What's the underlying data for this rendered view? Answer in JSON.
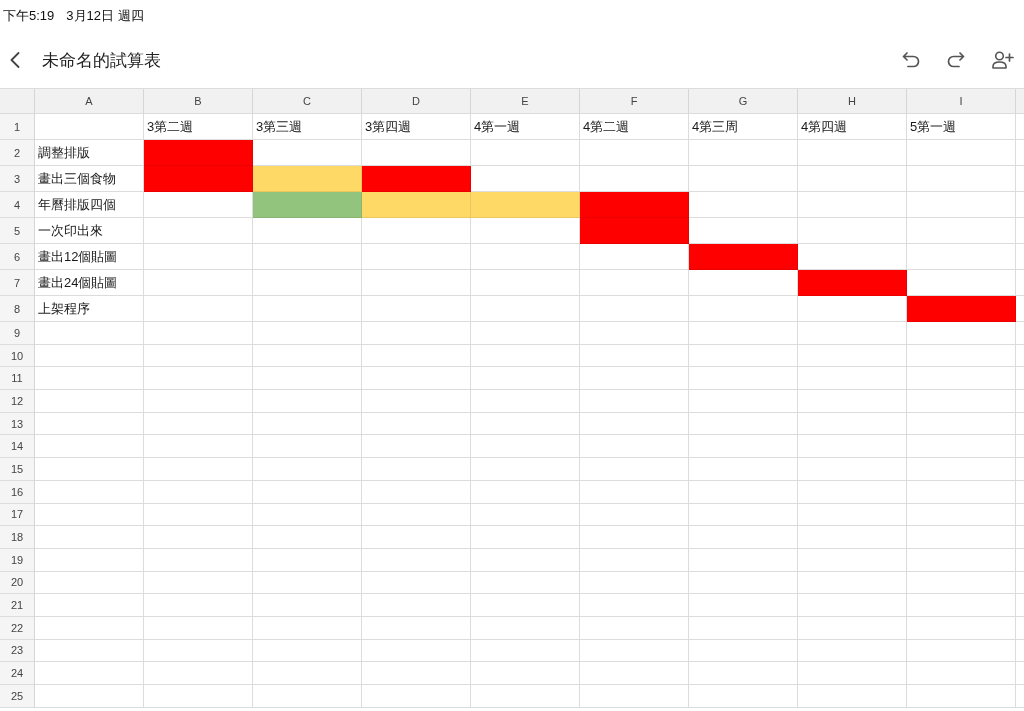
{
  "status_bar": {
    "time": "下午5:19",
    "date": "3月12日 週四"
  },
  "toolbar": {
    "title": "未命名的試算表"
  },
  "sheet": {
    "columns": [
      "A",
      "B",
      "C",
      "D",
      "E",
      "F",
      "G",
      "H",
      "I"
    ],
    "rows": [
      {
        "number": "1",
        "cells": [
          {},
          {
            "text": "3第二週"
          },
          {
            "text": "3第三週"
          },
          {
            "text": "3第四週"
          },
          {
            "text": "4第一週"
          },
          {
            "text": "4第二週"
          },
          {
            "text": "4第三周"
          },
          {
            "text": "4第四週"
          },
          {
            "text": "5第一週"
          }
        ]
      },
      {
        "number": "2",
        "cells": [
          {
            "text": "調整排版"
          },
          {
            "color": "#ff0000"
          }
        ]
      },
      {
        "number": "3",
        "cells": [
          {
            "text": "畫出三個食物"
          },
          {
            "color": "#ff0000"
          },
          {
            "color": "#ffd966"
          },
          {
            "color": "#ff0000"
          }
        ]
      },
      {
        "number": "4",
        "cells": [
          {
            "text": "年曆排版四個"
          },
          {},
          {
            "color": "#93c47d"
          },
          {
            "color": "#ffd966"
          },
          {
            "color": "#ffd966"
          },
          {
            "color": "#ff0000"
          }
        ]
      },
      {
        "number": "5",
        "cells": [
          {
            "text": "一次印出來"
          },
          {},
          {},
          {},
          {},
          {
            "color": "#ff0000"
          }
        ]
      },
      {
        "number": "6",
        "cells": [
          {
            "text": "畫出12個貼圖"
          },
          {},
          {},
          {},
          {},
          {},
          {
            "color": "#ff0000"
          }
        ]
      },
      {
        "number": "7",
        "cells": [
          {
            "text": "畫出24個貼圖"
          },
          {},
          {},
          {},
          {},
          {},
          {},
          {
            "color": "#ff0000"
          }
        ]
      },
      {
        "number": "8",
        "cells": [
          {
            "text": "上架程序"
          },
          {},
          {},
          {},
          {},
          {},
          {},
          {},
          {
            "color": "#ff0000"
          }
        ]
      },
      {
        "number": "9"
      },
      {
        "number": "10"
      },
      {
        "number": "11"
      },
      {
        "number": "12"
      },
      {
        "number": "13"
      },
      {
        "number": "14"
      },
      {
        "number": "15"
      },
      {
        "number": "16"
      },
      {
        "number": "17"
      },
      {
        "number": "18"
      },
      {
        "number": "19"
      },
      {
        "number": "20"
      },
      {
        "number": "21"
      },
      {
        "number": "22"
      },
      {
        "number": "23"
      },
      {
        "number": "24"
      },
      {
        "number": "25"
      }
    ]
  }
}
